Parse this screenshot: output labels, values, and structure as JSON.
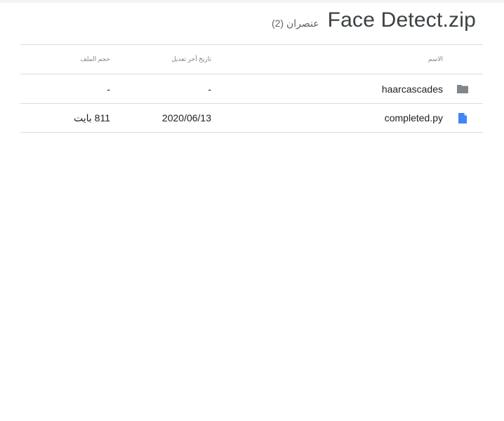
{
  "header": {
    "title": "Face Detect.zip",
    "item_count": "عنصران (2)"
  },
  "table": {
    "columns": {
      "name": "الاسم",
      "modified": "تاريخ آخر تعديل",
      "size": "حجم الملف"
    },
    "rows": [
      {
        "name": "haarcascades",
        "modified": "-",
        "size": "-",
        "icon": "folder-icon",
        "icon_color": "#80868b"
      },
      {
        "name": "completed.py",
        "modified": "2020/06/13",
        "size": "811 بايت",
        "icon": "file-icon",
        "icon_color": "#4285f4"
      }
    ]
  }
}
